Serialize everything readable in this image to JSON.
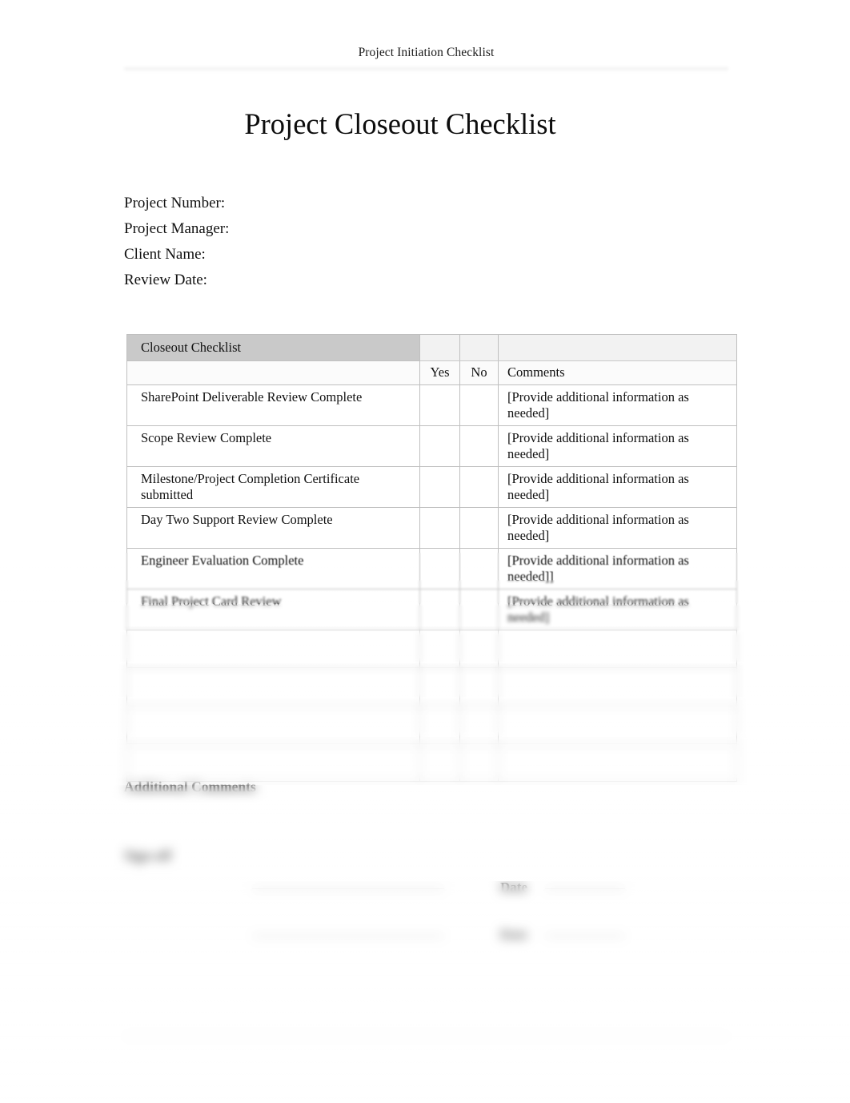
{
  "document": {
    "running_header": "Project Initiation Checklist",
    "title": "Project Closeout Checklist"
  },
  "meta_fields": [
    {
      "label": "Project Number:"
    },
    {
      "label": "Project Manager:"
    },
    {
      "label": "Client Name:"
    },
    {
      "label": "Review Date:"
    }
  ],
  "checklist_table": {
    "header_title": "Closeout Checklist",
    "columns": {
      "item": "",
      "yes": "Yes",
      "no": "No",
      "comments": "Comments"
    },
    "rows": [
      {
        "item": "SharePoint Deliverable Review Complete",
        "yes": "",
        "no": "",
        "comments": "[Provide additional information as needed]"
      },
      {
        "item": "Scope Review Complete",
        "yes": "",
        "no": "",
        "comments": "[Provide additional information as needed]"
      },
      {
        "item": "Milestone/Project Completion Certificate submitted",
        "yes": "",
        "no": "",
        "comments": "[Provide additional information as needed]"
      },
      {
        "item": "Day Two Support Review Complete",
        "yes": "",
        "no": "",
        "comments": "[Provide additional information as needed]"
      },
      {
        "item": "Engineer Evaluation Complete",
        "yes": "",
        "no": "",
        "comments": "[Provide additional information as needed]]"
      },
      {
        "item": "Final Project Card Review",
        "yes": "",
        "no": "",
        "comments": "[Provide additional information as needed]"
      },
      {
        "item": "",
        "yes": "",
        "no": "",
        "comments": ""
      },
      {
        "item": "",
        "yes": "",
        "no": "",
        "comments": ""
      },
      {
        "item": "",
        "yes": "",
        "no": "",
        "comments": ""
      },
      {
        "item": "",
        "yes": "",
        "no": "",
        "comments": ""
      }
    ]
  },
  "additional_comments": {
    "heading": "Additional Comments",
    "note": ""
  },
  "signoff": {
    "heading": "Sign-off",
    "date_label": "Date",
    "rows": [
      {
        "role": ""
      },
      {
        "role": ""
      }
    ]
  },
  "footer": {
    "left": "",
    "center": "",
    "right": ""
  }
}
